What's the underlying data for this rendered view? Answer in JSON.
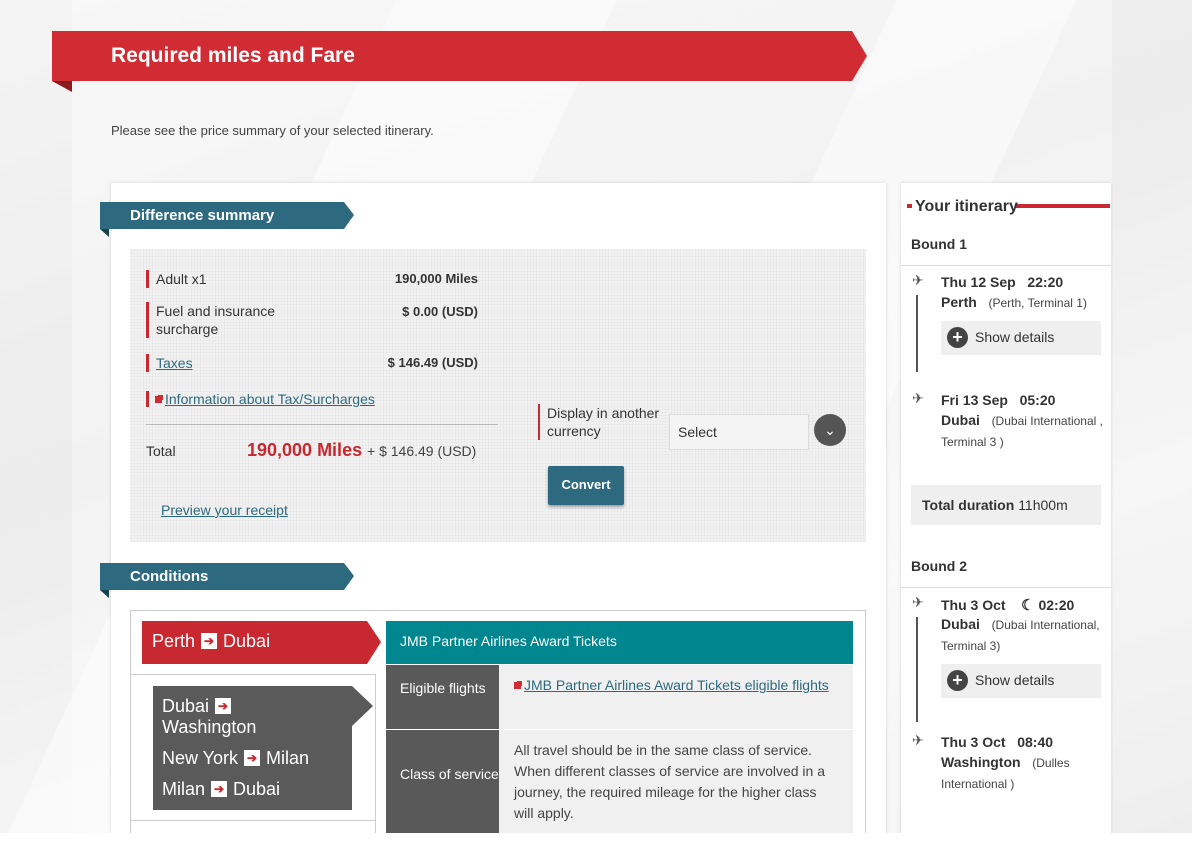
{
  "header": {
    "title": "Required miles and Fare",
    "intro": "Please see the price summary of your selected itinerary."
  },
  "difference_summary": {
    "heading": "Difference summary",
    "rows": [
      {
        "label": "Adult x1",
        "value": "190,000 Miles"
      },
      {
        "label": "Fuel and insurance surcharge",
        "value": "$ 0.00 (USD)"
      },
      {
        "label": "Taxes",
        "value": "$ 146.49 (USD)"
      }
    ],
    "tax_info_link": "Information about Tax/Surcharges",
    "total_label": "Total",
    "total_miles": "190,000 Miles",
    "total_extra": "+ $ 146.49 (USD)",
    "preview_link": "Preview your receipt",
    "currency_label": "Display in another currency",
    "currency_select": "Select",
    "convert_label": "Convert"
  },
  "conditions": {
    "heading": "Conditions",
    "main_route": {
      "from": "Perth",
      "to": "Dubai"
    },
    "other_routes": [
      {
        "from": "Dubai",
        "to": "Washington"
      },
      {
        "from": "New York",
        "to": "Milan"
      },
      {
        "from": "Milan",
        "to": "Dubai"
      }
    ],
    "table_title": "JMB Partner Airlines Award Tickets",
    "eligible_label": "Eligible flights",
    "eligible_link": "JMB Partner Airlines Award Tickets eligible flights",
    "class_label": "Class of service",
    "class_text": "All travel should be in the same class of service. When different classes of service are involved in a journey, the required mileage for the higher class will apply."
  },
  "itinerary": {
    "title": "Your itinerary",
    "bounds": [
      {
        "label": "Bound 1",
        "depart": {
          "date": "Thu 12 Sep",
          "time": "22:20",
          "city": "Perth",
          "airport": "(Perth, Terminal  1)"
        },
        "arrive": {
          "date": "Fri 13 Sep",
          "time": "05:20",
          "city": "Dubai",
          "airport": "(Dubai International , Terminal   3 )"
        },
        "show_details": "Show details",
        "total_duration_label": "Total duration",
        "total_duration": "11h00m"
      },
      {
        "label": "Bound 2",
        "depart": {
          "date": "Thu 3 Oct",
          "time": "02:20",
          "city": "Dubai",
          "airport": "(Dubai International, Terminal  3)"
        },
        "arrive": {
          "date": "Thu 3 Oct",
          "time": "08:40",
          "city": "Washington",
          "airport": "(Dulles International )"
        },
        "show_details": "Show details"
      }
    ]
  },
  "colors": {
    "brand_red": "#d12b33",
    "teal": "#2d6a7f",
    "accent_teal": "#00868f"
  }
}
